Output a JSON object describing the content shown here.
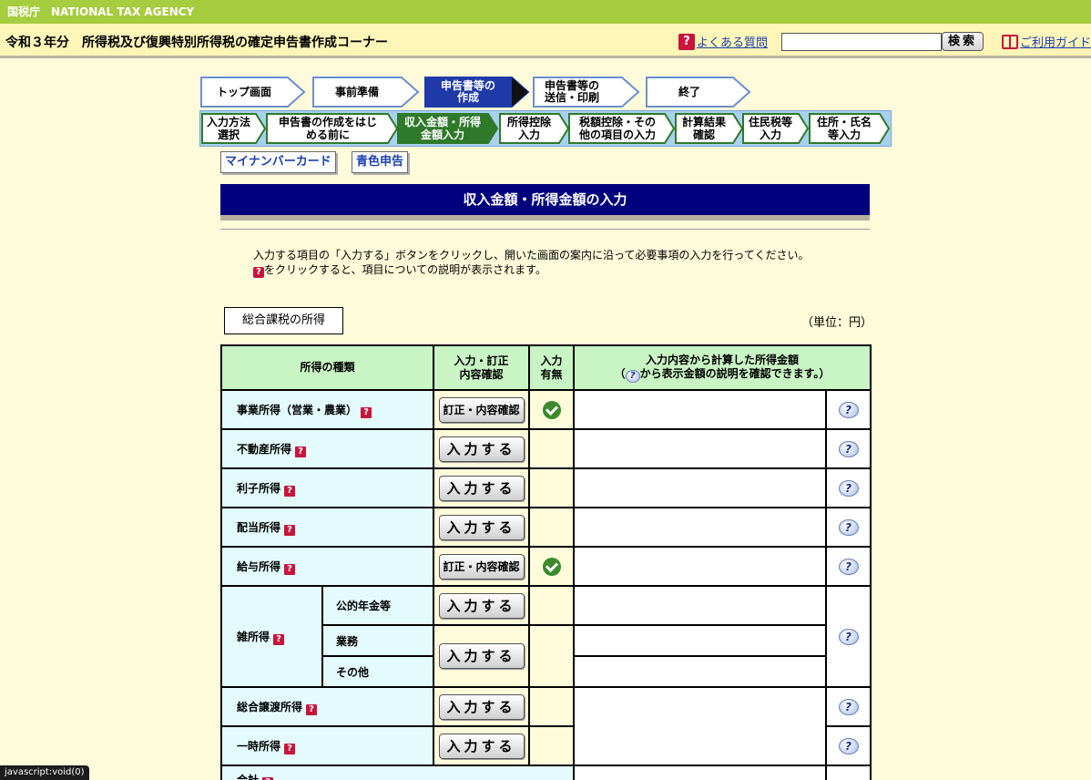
{
  "agency": "国税庁　NATIONAL TAX AGENCY",
  "header": {
    "title": "令和３年分　所得税及び復興特別所得税の確定申告書作成コーナー",
    "faq_label": "よくある質問",
    "search_placeholder": "",
    "search_button": "検索",
    "guide_label": "ご利用ガイド"
  },
  "steps": [
    {
      "label": "トップ画面"
    },
    {
      "label": "事前準備"
    },
    {
      "label": "申告書等の\n作成",
      "active": true
    },
    {
      "label": "申告書等の\n送信・印刷"
    },
    {
      "label": "終了"
    }
  ],
  "substeps": [
    {
      "label": "入力方法\n選択"
    },
    {
      "label": "申告書の作成をはじ\nめる前に"
    },
    {
      "label": "収入金額・所得\n金額入力",
      "active": true
    },
    {
      "label": "所得控除\n入力"
    },
    {
      "label": "税額控除・その\n他の項目の入力"
    },
    {
      "label": "計算結果\n確認"
    },
    {
      "label": "住民税等\n入力"
    },
    {
      "label": "住所・氏名\n等入力"
    }
  ],
  "pills": {
    "mynumber": "マイナンバーカード",
    "blue": "青色申告"
  },
  "section_title": "収入金額・所得金額の入力",
  "instructions": {
    "line1": "入力する項目の「入力する」ボタンをクリックし、開いた画面の案内に沿って必要事項の入力を行ってください。",
    "line2": "をクリックすると、項目についての説明が表示されます。"
  },
  "tab_label": "総合課税の所得",
  "unit": "（単位：円）",
  "table": {
    "col_type": "所得の種類",
    "col_entry": "入力・訂正\n内容確認",
    "col_status": "入力\n有無",
    "col_amount_1": "入力内容から計算した所得金額",
    "col_amount_2a": "（",
    "col_amount_2b": "から表示金額の説明を確認できます。）",
    "btn_enter": "入力する",
    "btn_edit": "訂正・内容確認",
    "rows": {
      "business": "事業所得（営業・農業）",
      "realestate": "不動産所得",
      "interest": "利子所得",
      "dividend": "配当所得",
      "salary": "給与所得",
      "misc": "雑所得",
      "misc_pension": "公的年金等",
      "misc_work": "業務",
      "misc_other": "その他",
      "transfer": "総合譲渡所得",
      "temporary": "一時所得",
      "total": "合計"
    }
  },
  "status_bar": "javascript:void(0)",
  "colors": {
    "accent_green": "#a6cc3f",
    "header_blue": "#00007f",
    "step_active": "#1f3aa8",
    "substep_active": "#2e7a2a"
  }
}
